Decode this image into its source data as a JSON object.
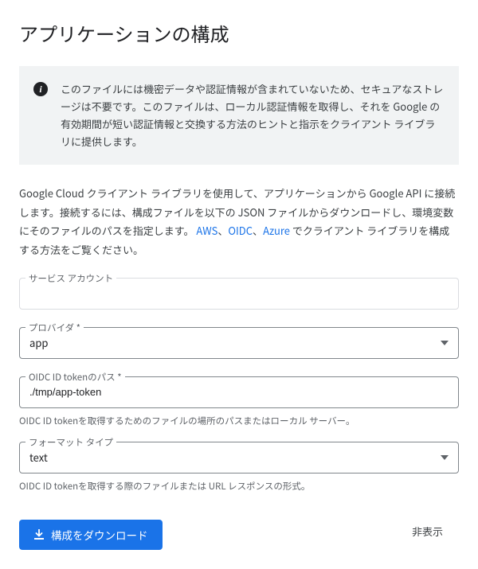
{
  "title": "アプリケーションの構成",
  "info": {
    "text": "このファイルには機密データや認証情報が含まれていないため、セキュアなストレージは不要です。このファイルは、ローカル認証情報を取得し、それを Google の有効期間が短い認証情報と交換する方法のヒントと指示をクライアント ライブラリに提供します。"
  },
  "description": {
    "part1": "Google Cloud クライアント ライブラリを使用して、アプリケーションから Google API に接続します。接続するには、構成ファイルを以下の JSON ファイルからダウンロードし、環境変数にそのファイルのパスを指定します。",
    "link_aws": "AWS",
    "sep1": "、",
    "link_oidc": "OIDC",
    "sep2": "、",
    "link_azure": "Azure",
    "part2": " でクライアント ライブラリを構成する方法をご覧ください。"
  },
  "fields": {
    "service_account": {
      "label": "サービス アカウント",
      "value": ""
    },
    "provider": {
      "label": "プロバイダ *",
      "value": "app"
    },
    "oidc_path": {
      "label": "OIDC ID tokenのパス *",
      "value": "./tmp/app-token",
      "helper": "OIDC ID tokenを取得するためのファイルの場所のパスまたはローカル サーバー。"
    },
    "format_type": {
      "label": "フォーマット タイプ",
      "value": "text",
      "helper": "OIDC ID tokenを取得する際のファイルまたは URL レスポンスの形式。"
    }
  },
  "buttons": {
    "download": "構成をダウンロード",
    "dismiss": "非表示"
  }
}
